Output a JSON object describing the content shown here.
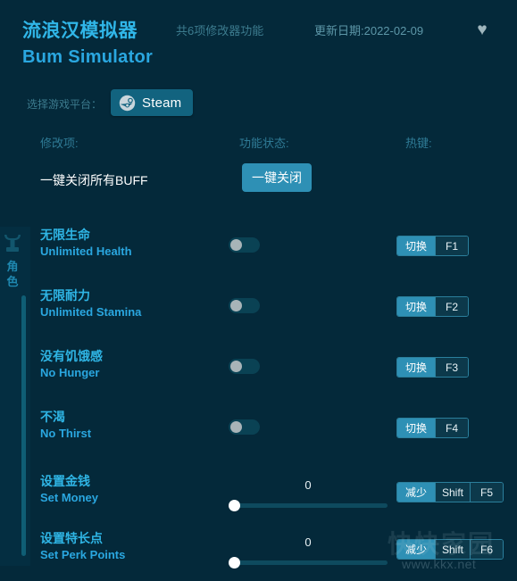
{
  "app": {
    "title_cn": "流浪汉模拟器",
    "title_en": "Bum Simulator",
    "feature_count_text": "共6项修改器功能",
    "update_date_text": "更新日期:2022-02-09",
    "favorite_icon": "♥",
    "accent_color": "#2e90b5",
    "background_color": "#04293a",
    "rail_color": "#042e41",
    "cn_text_color": "#2fb5e5",
    "en_text_color": "#2aa7e0"
  },
  "platform": {
    "label": "选择游戏平台：",
    "selected": "Steam",
    "icon": "steam-icon"
  },
  "columns": {
    "modifier": "修改项:",
    "status": "功能状态:",
    "hotkey": "热键:"
  },
  "master": {
    "label": "一键关闭所有BUFF",
    "button": "一键关闭"
  },
  "category": {
    "icon": "character-icon",
    "label": "角色"
  },
  "rows": [
    {
      "name_cn": "无限生命",
      "name_en": "Unlimited Health",
      "control": "toggle",
      "toggle_on": false,
      "hotkey_action": "切换",
      "hotkey_keys": [
        "F1"
      ]
    },
    {
      "name_cn": "无限耐力",
      "name_en": "Unlimited Stamina",
      "control": "toggle",
      "toggle_on": false,
      "hotkey_action": "切换",
      "hotkey_keys": [
        "F2"
      ]
    },
    {
      "name_cn": "没有饥饿感",
      "name_en": "No Hunger",
      "control": "toggle",
      "toggle_on": false,
      "hotkey_action": "切换",
      "hotkey_keys": [
        "F3"
      ]
    },
    {
      "name_cn": "不渴",
      "name_en": "No Thirst",
      "control": "toggle",
      "toggle_on": false,
      "hotkey_action": "切换",
      "hotkey_keys": [
        "F4"
      ]
    },
    {
      "name_cn": "设置金钱",
      "name_en": "Set Money",
      "control": "slider",
      "value": "0",
      "slider_percent": 0,
      "hotkey_action": "减少",
      "hotkey_keys": [
        "Shift",
        "F5"
      ]
    },
    {
      "name_cn": "设置特长点",
      "name_en": "Set Perk Points",
      "control": "slider",
      "value": "0",
      "slider_percent": 0,
      "hotkey_action": "减少",
      "hotkey_keys": [
        "Shift",
        "F6"
      ]
    }
  ],
  "watermark": {
    "cn": "快快家园",
    "url": "www.kkx.net"
  }
}
